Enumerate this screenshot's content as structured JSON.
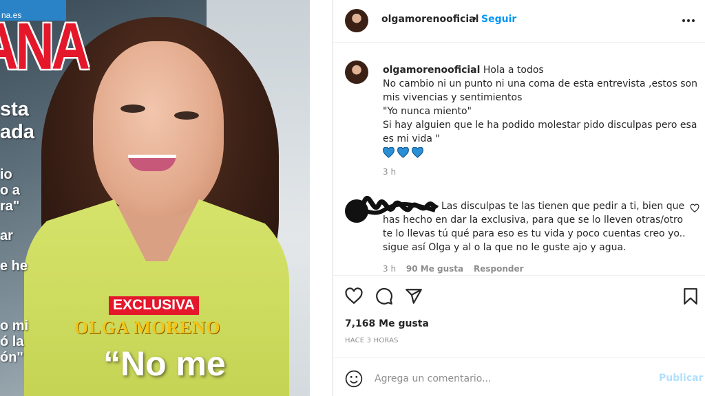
{
  "cover": {
    "url_text": "na.es",
    "masthead": "ANA",
    "lines": [
      "sta",
      "ada",
      "io",
      "o a",
      "ra\"",
      "ar",
      "e he",
      "o mi",
      "ó la",
      "ón\""
    ],
    "exclusive_label": "EXCLUSIVA",
    "person_name": "OLGA MORENO",
    "headline": "“No me"
  },
  "header": {
    "username": "olgamorenooficial",
    "separator": "•",
    "follow_label": "Seguir",
    "more_icon": "more-horizontal-icon"
  },
  "caption": {
    "username": "olgamorenooficial",
    "lines": [
      "Hola a todos",
      "No cambio ni un punto ni una coma de esta entrevista ,estos son mis vivencias y sentimientos",
      "\"Yo nunca miento\"",
      "Si hay alguien que le ha podido molestar pido disculpas pero esa es mi vida \""
    ],
    "heart_color": "#2b8fd6",
    "time": "3 h"
  },
  "comment": {
    "text": "Las disculpas te las tienen que pedir a ti, bien que has hecho en dar la exclusiva, para que se lo lleven otras/otro te lo llevas tú qué para eso es tu vida y poco cuentas creo yo.. sigue así Olga y al o la que no le guste ajo y agua.",
    "time": "3 h",
    "likes": "90 Me gusta",
    "reply_label": "Responder"
  },
  "actions": {
    "like_icon": "heart-outline-icon",
    "comment_icon": "comment-icon",
    "share_icon": "send-icon",
    "save_icon": "bookmark-icon"
  },
  "post": {
    "likes": "7,168 Me gusta",
    "time_ago": "HACE 3 HORAS"
  },
  "add_comment": {
    "placeholder": "Agrega un comentario...",
    "publish_label": "Publicar",
    "publish_color": "#b2dffc"
  }
}
